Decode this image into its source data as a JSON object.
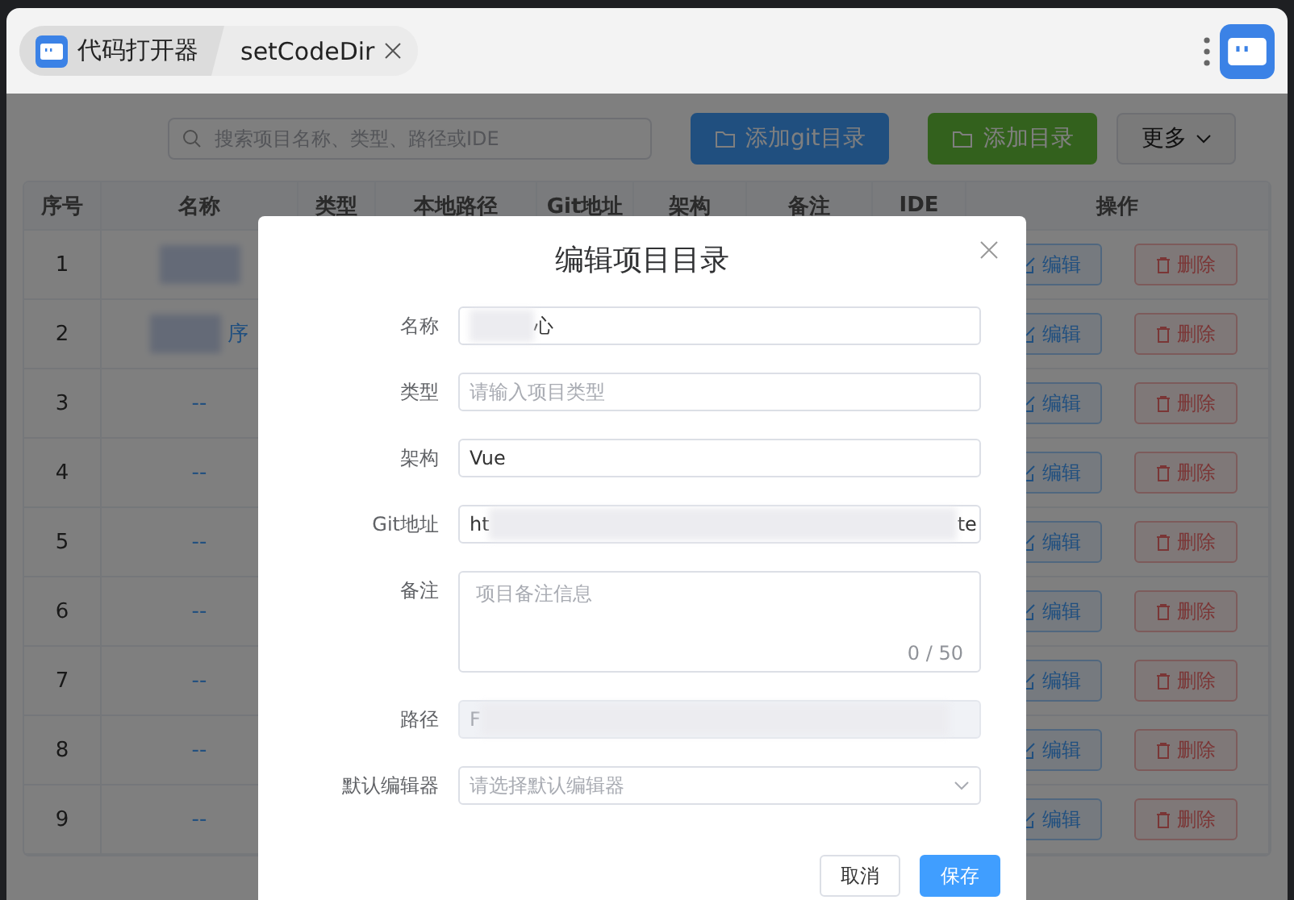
{
  "tabs": [
    {
      "label": "代码打开器",
      "selected": true,
      "closable": false
    },
    {
      "label": "setCodeDir",
      "selected": false,
      "closable": true
    }
  ],
  "toolbar": {
    "search": {
      "placeholder": "搜索项目名称、类型、路径或IDE"
    },
    "buttons": [
      {
        "label": "添加git目录",
        "kind": "primary"
      },
      {
        "label": "添加目录",
        "kind": "success"
      },
      {
        "label": "更多",
        "kind": "dropdown"
      }
    ]
  },
  "table": {
    "columns": [
      "序号",
      "名称",
      "类型",
      "本地路径",
      "Git地址",
      "架构",
      "备注",
      "IDE",
      "操作"
    ],
    "rows": [
      {
        "index": "1",
        "name_blurred": true,
        "actions": [
          "编辑",
          "删除"
        ]
      },
      {
        "index": "2",
        "name": "序",
        "name_blurred": true,
        "actions": [
          "编辑",
          "删除"
        ]
      },
      {
        "index": "3",
        "name": "--",
        "name_blurred": false,
        "actions": [
          "编辑",
          "删除"
        ]
      },
      {
        "index": "4",
        "name": "--",
        "name_blurred": false,
        "actions": [
          "编辑",
          "删除"
        ]
      },
      {
        "index": "5",
        "name": "--",
        "name_blurred": false,
        "actions": [
          "编辑",
          "删除"
        ]
      },
      {
        "index": "6",
        "name": "--",
        "name_blurred": false,
        "actions": [
          "编辑",
          "删除"
        ]
      },
      {
        "index": "7",
        "name": "--",
        "name_blurred": false,
        "actions": [
          "编辑",
          "删除"
        ]
      },
      {
        "index": "8",
        "name": "--",
        "name_blurred": false,
        "actions": [
          "编辑",
          "删除"
        ]
      },
      {
        "index": "9",
        "name": "--",
        "name_blurred": false,
        "actions": [
          "编辑",
          "删除"
        ]
      }
    ]
  },
  "dialog": {
    "title": "编辑项目目录",
    "fields": [
      {
        "kind": "text",
        "label": "名称",
        "value_end": "心",
        "blurred": true,
        "disabled": false
      },
      {
        "kind": "text",
        "label": "类型",
        "placeholder": "请输入项目类型",
        "blurred": false,
        "disabled": false
      },
      {
        "kind": "text",
        "label": "架构",
        "value_start": "Vue",
        "blurred": false,
        "disabled": false
      },
      {
        "kind": "text",
        "label": "Git地址",
        "value_start": "ht",
        "value_end": "te",
        "blurred": true,
        "disabled": false
      },
      {
        "kind": "textarea",
        "label": "备注",
        "placeholder": "项目备注信息",
        "counter": "0 / 50",
        "blurred": false,
        "disabled": false
      },
      {
        "kind": "text",
        "label": "路径",
        "value_start": "F",
        "blurred": true,
        "disabled": true
      },
      {
        "kind": "select",
        "label": "默认编辑器",
        "placeholder": "请选择默认编辑器",
        "blurred": false,
        "disabled": false
      }
    ],
    "buttons": [
      {
        "label": "取消",
        "kind": "default"
      },
      {
        "label": "保存",
        "kind": "primary"
      }
    ]
  }
}
